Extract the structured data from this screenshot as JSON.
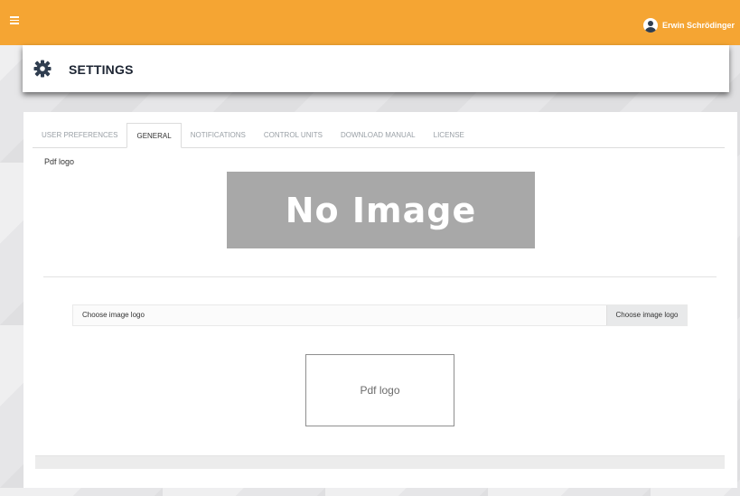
{
  "topbar": {
    "menu_icon": "hamburger-menu-icon",
    "user_icon": "user-avatar-icon",
    "user_name": "Erwin Schrödinger",
    "color": "#f5a533"
  },
  "header": {
    "icon": "gear-icon",
    "title": "SETTINGS"
  },
  "tabs": [
    {
      "label": "USER PREFERENCES",
      "active": false
    },
    {
      "label": "GENERAL",
      "active": true
    },
    {
      "label": "NOTIFICATIONS",
      "active": false
    },
    {
      "label": "CONTROL UNITS",
      "active": false
    },
    {
      "label": "DOWNLOAD MANUAL",
      "active": false
    },
    {
      "label": "LICENSE",
      "active": false
    }
  ],
  "general": {
    "pdf_logo_label": "Pdf logo",
    "placeholder_image_text": "No Image",
    "file_input_label": "Choose image logo",
    "file_button_label": "Choose image logo",
    "preview_text": "Pdf logo"
  }
}
